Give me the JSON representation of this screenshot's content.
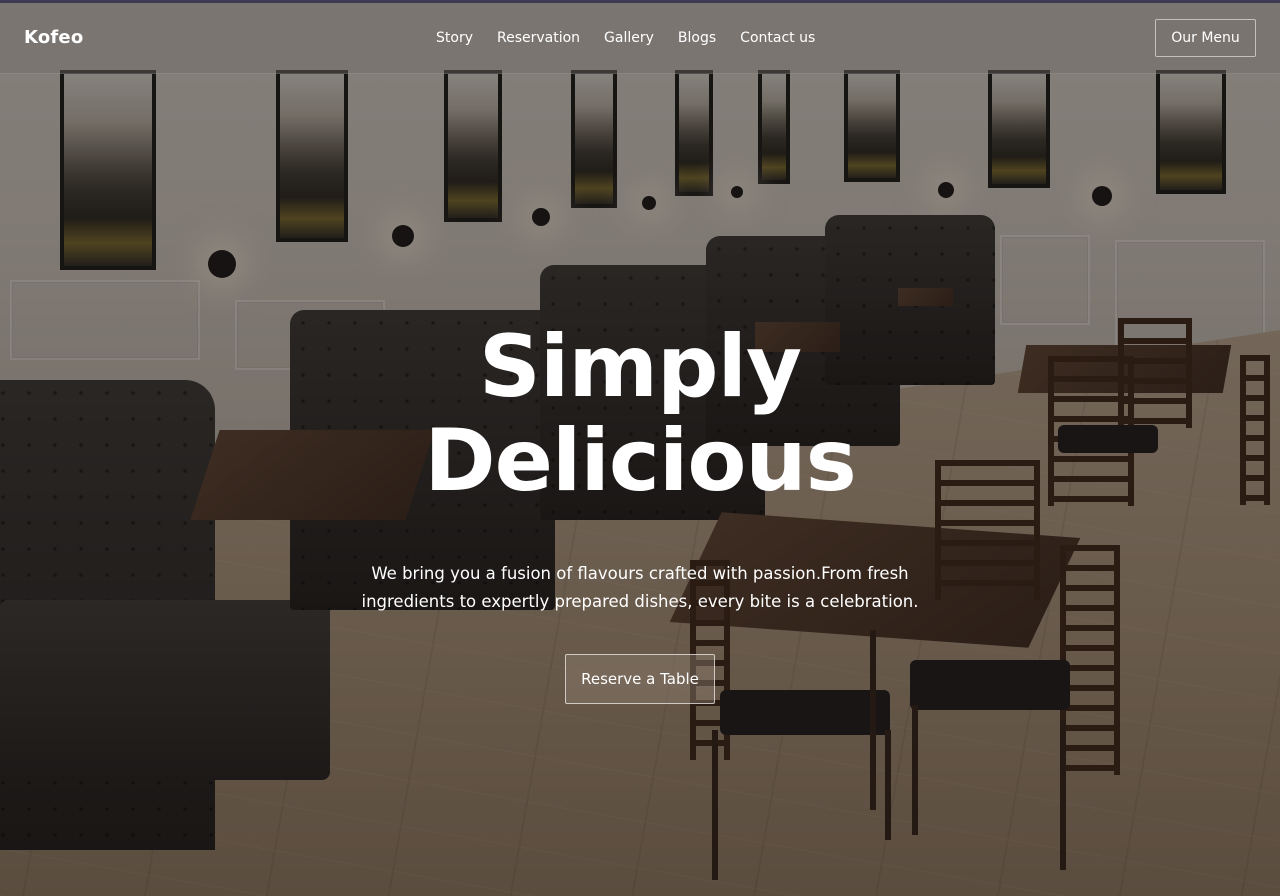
{
  "brand": {
    "name": "Kofeo"
  },
  "nav": {
    "items": [
      {
        "label": "Story"
      },
      {
        "label": "Reservation"
      },
      {
        "label": "Gallery"
      },
      {
        "label": "Blogs"
      },
      {
        "label": "Contact us"
      }
    ]
  },
  "header": {
    "menu_button_label": "Our Menu"
  },
  "hero": {
    "title_line1": "Simply",
    "title_line2": "Delicious",
    "subtitle": "We bring you a fusion of flavours crafted with passion.From fresh ingredients to expertly prepared dishes, every bite is a celebration.",
    "cta_label": "Reserve a Table"
  },
  "colors": {
    "text": "#ffffff",
    "header_bg": "#6e6866",
    "topline": "#3e3a52"
  }
}
